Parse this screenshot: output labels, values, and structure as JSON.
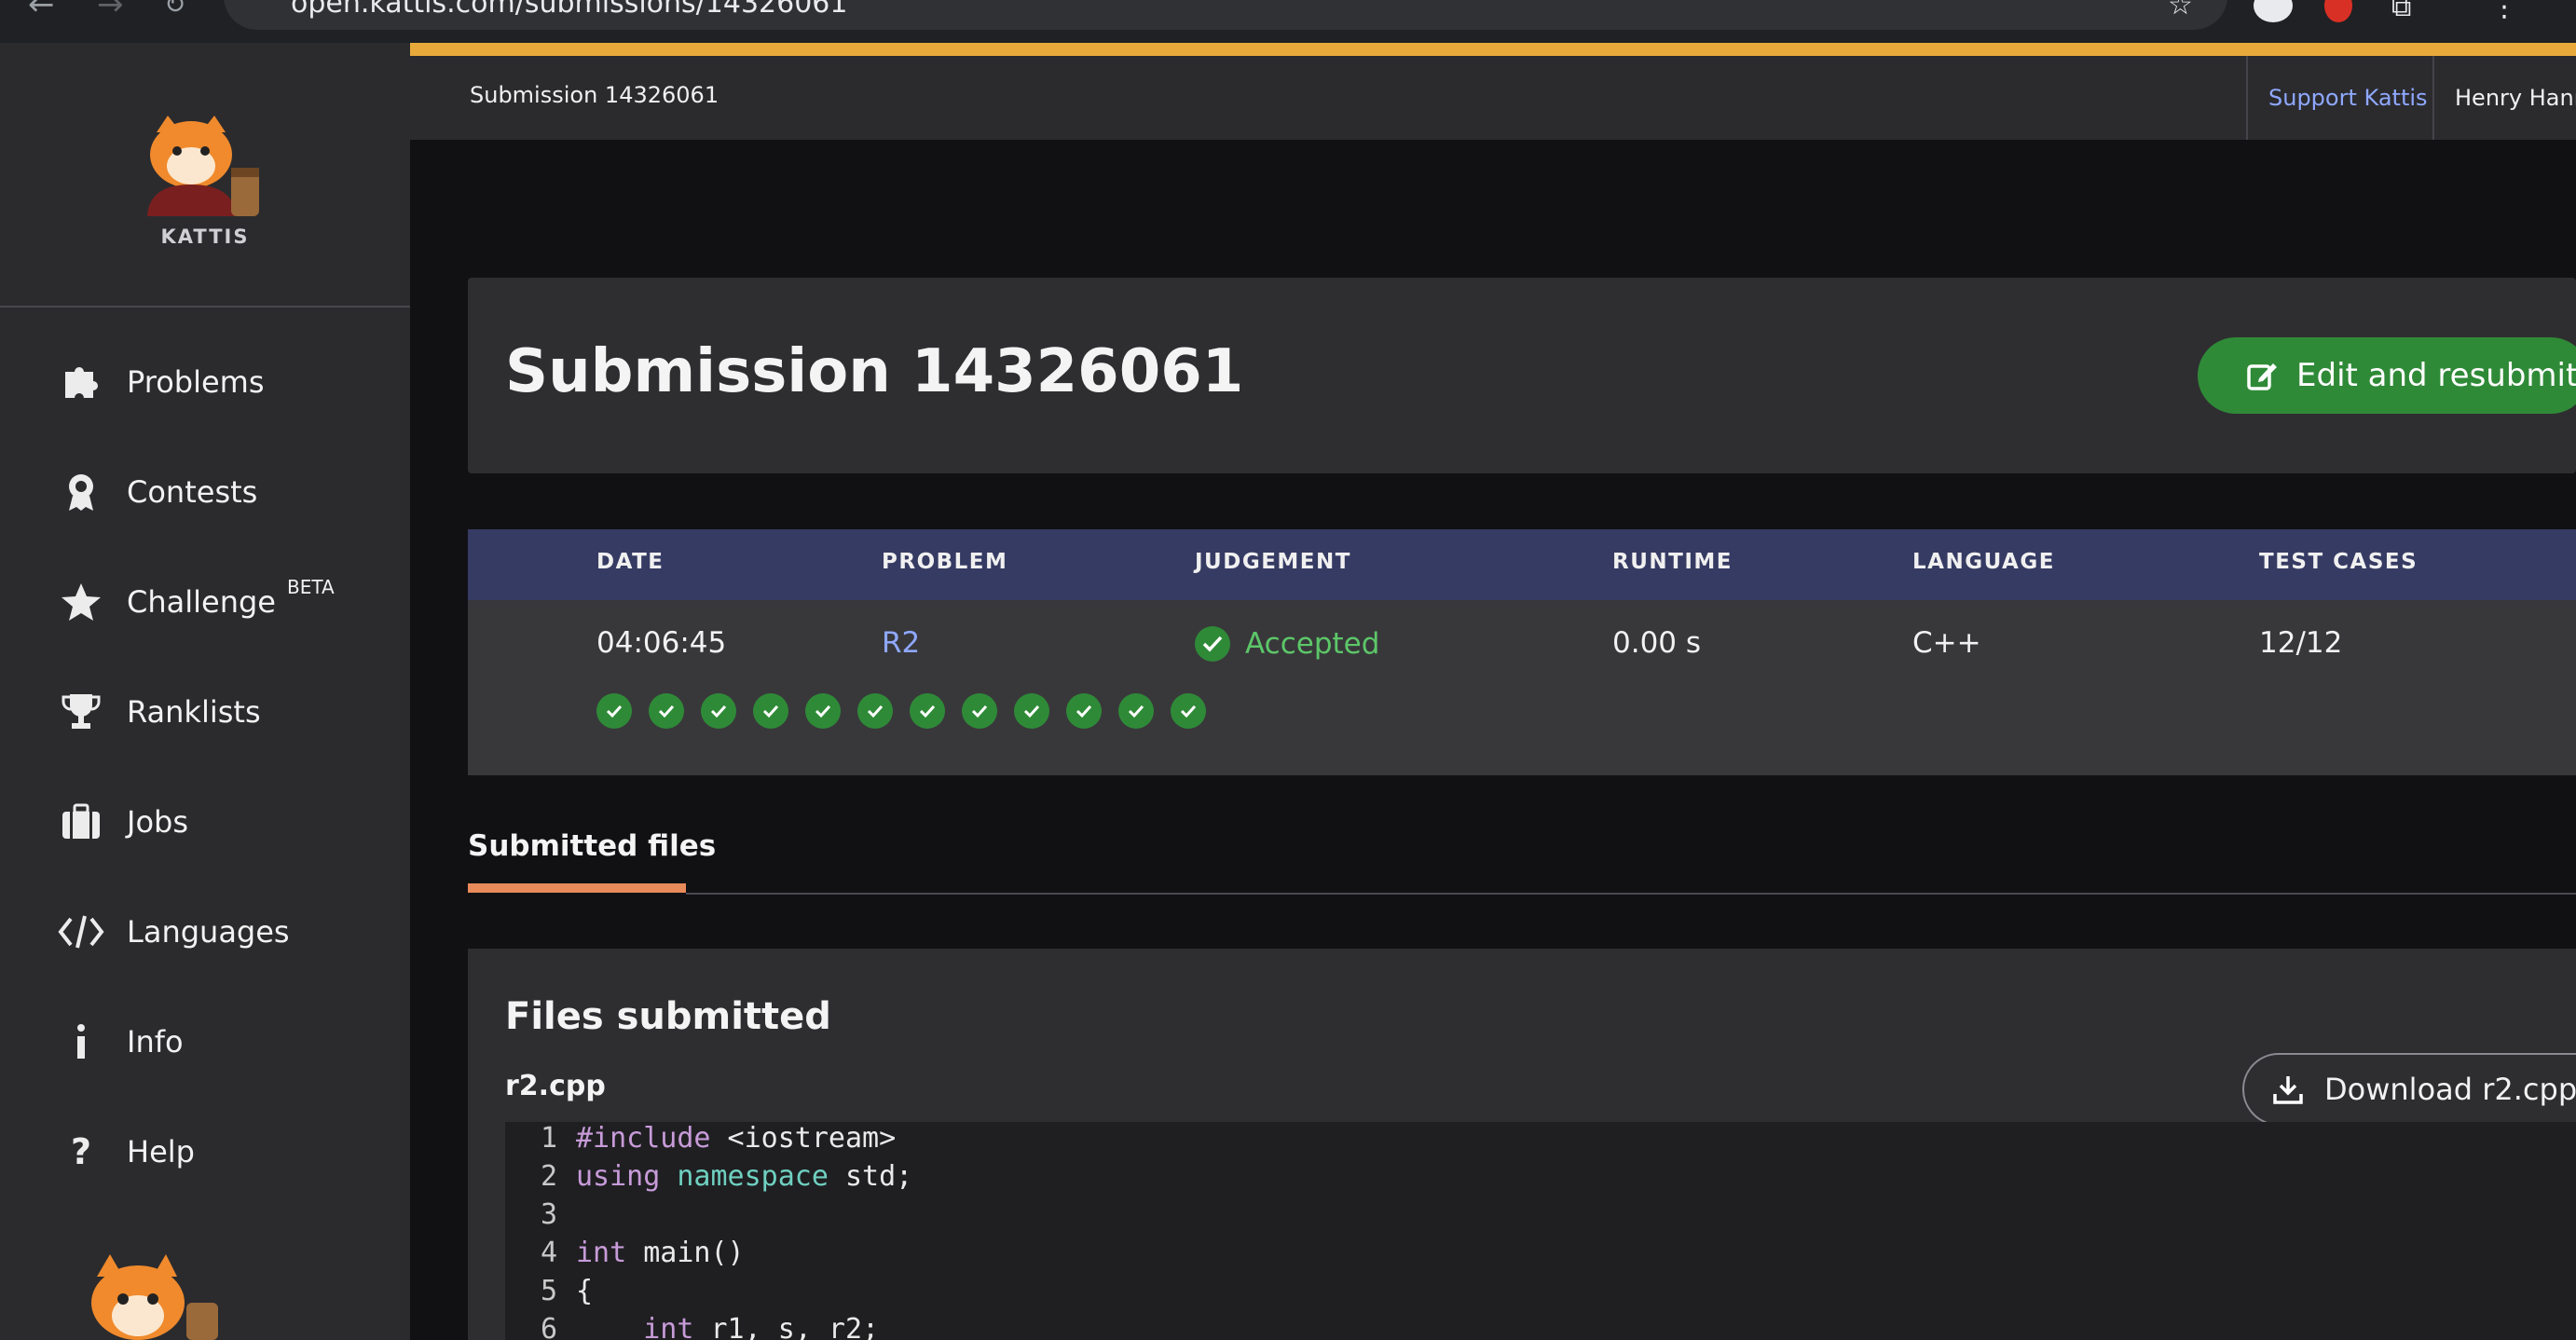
{
  "browser": {
    "url": "open.kattis.com/submissions/14326061"
  },
  "sidebar": {
    "logo_text": "KATTIS",
    "items": [
      {
        "label": "Problems",
        "icon": "puzzle-icon"
      },
      {
        "label": "Contests",
        "icon": "award-icon"
      },
      {
        "label": "Challenge",
        "icon": "star-icon",
        "badge": "BETA"
      },
      {
        "label": "Ranklists",
        "icon": "trophy-icon"
      },
      {
        "label": "Jobs",
        "icon": "briefcase-icon"
      },
      {
        "label": "Languages",
        "icon": "code-icon"
      },
      {
        "label": "Info",
        "icon": "info-icon"
      },
      {
        "label": "Help",
        "icon": "question-icon"
      }
    ]
  },
  "topbar": {
    "breadcrumb": "Submission 14326061",
    "support_link": "Support Kattis",
    "user_name": "Henry Hanna"
  },
  "header": {
    "title": "Submission 14326061",
    "resubmit_label": "Edit and resubmit"
  },
  "table": {
    "headers": [
      "DATE",
      "PROBLEM",
      "JUDGEMENT",
      "RUNTIME",
      "LANGUAGE",
      "TEST CASES"
    ],
    "row": {
      "date": "04:06:45",
      "problem": "R2",
      "judgement": "Accepted",
      "runtime": "0.00 s",
      "language": "C++",
      "test_cases": "12/12"
    },
    "test_case_results": [
      "passed",
      "passed",
      "passed",
      "passed",
      "passed",
      "passed",
      "passed",
      "passed",
      "passed",
      "passed",
      "passed",
      "passed"
    ]
  },
  "tabs": {
    "active": "Submitted files"
  },
  "files": {
    "title": "Files submitted",
    "file_name": "r2.cpp",
    "download_label": "Download r2.cpp",
    "code_lines": [
      {
        "n": "1",
        "parts": [
          [
            "kw-pre",
            "#include"
          ],
          [
            "plain",
            " <iostream>"
          ]
        ]
      },
      {
        "n": "2",
        "parts": [
          [
            "kw",
            "using"
          ],
          [
            "plain",
            " "
          ],
          [
            "kw-ns",
            "namespace"
          ],
          [
            "plain",
            " std;"
          ]
        ]
      },
      {
        "n": "3",
        "parts": [
          [
            "plain",
            ""
          ]
        ]
      },
      {
        "n": "4",
        "parts": [
          [
            "kw",
            "int"
          ],
          [
            "plain",
            " main()"
          ]
        ]
      },
      {
        "n": "5",
        "parts": [
          [
            "plain",
            "{"
          ]
        ]
      },
      {
        "n": "6",
        "parts": [
          [
            "plain",
            "    "
          ],
          [
            "kw",
            "int"
          ],
          [
            "plain",
            " r1, s, r2;"
          ]
        ]
      }
    ]
  },
  "colors": {
    "accent_bar": "#e8a93a",
    "success_green": "#2f8a37",
    "accepted_text": "#5cc768",
    "table_header": "#363b63",
    "link_blue": "#8fa8ff",
    "tab_underline": "#e98a5a"
  }
}
